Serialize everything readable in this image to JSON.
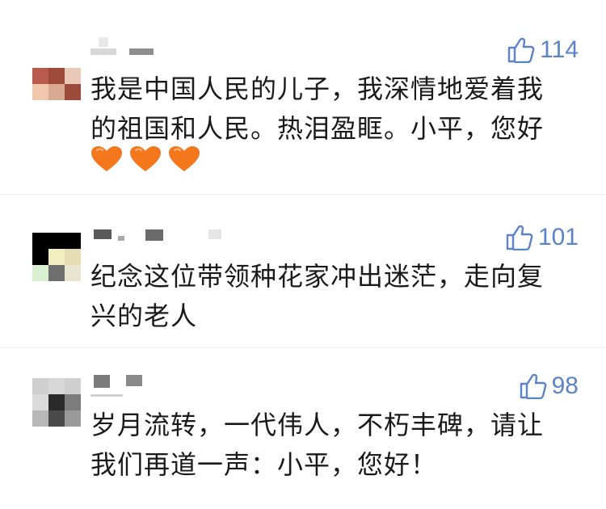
{
  "comments": [
    {
      "likes": "114",
      "text_lines": [
        "我是中国人民的儿子，我深情地爱着我",
        "的祖国和人民。热泪盈眶。小平，您好"
      ],
      "hearts": 3
    },
    {
      "likes": "101",
      "text_lines": [
        "纪念这位带领种花家冲出迷茫，走向复",
        "兴的老人"
      ],
      "hearts": 0
    },
    {
      "likes": "98",
      "text_lines": [
        "岁月流转，一代伟人，不朽丰碑，请让",
        "我们再道一声：小平，您好！"
      ],
      "hearts": 0
    }
  ],
  "icons": {
    "like": "thumbs-up-icon",
    "heart": "orange-heart-icon"
  },
  "colors": {
    "like": "#5a83c9",
    "text": "#1a1a1a",
    "heart": "#f4771e"
  }
}
